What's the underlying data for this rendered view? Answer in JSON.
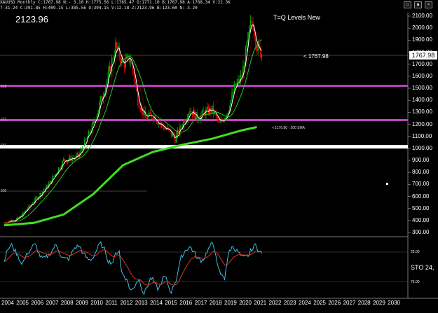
{
  "info": {
    "line1": "XAUUSD Monthly C:1767.98 N:- 3.10 H:1775.56 L:1765.47 O:1771.10 B:1767.98 A:1768.34 V:22.3K",
    "line2": "7-31-24 C:391.85 H:409.15 L:385.56 O:394.15 V:12.18 Z:2123.96 B:123.60 N:-3.20"
  },
  "last_price_label": "2123.96",
  "study_title": "T=Q Levels New",
  "price_note": "< 1767.98",
  "price_tag": "1767.98",
  "sma_note": "< 1176.80 - 200 SMA",
  "left_labels": [
    "818",
    "272",
    "660",
    "500"
  ],
  "price_axis": [
    "2100.00",
    "2000.00",
    "1900.00",
    "1800.00",
    "1700.00",
    "1600.00",
    "1500.00",
    "1400.00",
    "1300.00",
    "1200.00",
    "1100.00",
    "1000.00",
    "900.00",
    "800.00",
    "700.00",
    "600.00",
    "500.00",
    "400.00",
    "300.00"
  ],
  "osc_axis": [
    "25.00",
    "75.00"
  ],
  "sto_label": "STO 24,",
  "years": [
    "2004",
    "2005",
    "2006",
    "2007",
    "2008",
    "2009",
    "2010",
    "2011",
    "2012",
    "2013",
    "2014",
    "2015",
    "2016",
    "2017",
    "2018",
    "2019",
    "2020",
    "2021",
    "2022",
    "2023",
    "2024",
    "2025",
    "2026",
    "2027",
    "2028",
    "2029",
    "2030"
  ],
  "window_controls": [
    "▫",
    "▪",
    "×"
  ],
  "colors": {
    "background": "#000000",
    "up_candle": "#00b000",
    "down_candle": "#e00000",
    "level_magenta": "#c040c0",
    "level_white": "#ffffff",
    "sma_long": "#44dd22",
    "sma_mid": "#22cc22",
    "fast_line": "#ffffff",
    "osc_fast": "#40c0e0",
    "osc_slow": "#e03020"
  },
  "chart_data": {
    "type": "candlestick",
    "title": "T=Q Levels New",
    "levels": [
      {
        "price": 1520,
        "color": "#c040c0"
      },
      {
        "price": 1235,
        "color": "#c040c0"
      },
      {
        "price": 1013,
        "color": "#ffffff"
      }
    ],
    "close_path": [
      [
        2004,
        380
      ],
      [
        2005,
        420
      ],
      [
        2006,
        560
      ],
      [
        2007,
        700
      ],
      [
        2008,
        900
      ],
      [
        2009,
        930
      ],
      [
        2010,
        1200
      ],
      [
        2011,
        1600
      ],
      [
        2011.5,
        1850
      ],
      [
        2012,
        1700
      ],
      [
        2012.5,
        1750
      ],
      [
        2013,
        1400
      ],
      [
        2013.5,
        1250
      ],
      [
        2014,
        1280
      ],
      [
        2014.5,
        1200
      ],
      [
        2015,
        1150
      ],
      [
        2015.5,
        1080
      ],
      [
        2016,
        1200
      ],
      [
        2016.5,
        1330
      ],
      [
        2017,
        1250
      ],
      [
        2017.5,
        1300
      ],
      [
        2018,
        1320
      ],
      [
        2018.5,
        1200
      ],
      [
        2019,
        1300
      ],
      [
        2019.5,
        1500
      ],
      [
        2020,
        1600
      ],
      [
        2020.5,
        1980
      ],
      [
        2020.7,
        2070
      ],
      [
        2021,
        1850
      ],
      [
        2021.4,
        1770
      ]
    ],
    "sma_200": [
      [
        2004,
        360
      ],
      [
        2006,
        380
      ],
      [
        2008,
        450
      ],
      [
        2010,
        620
      ],
      [
        2012,
        860
      ],
      [
        2014,
        970
      ],
      [
        2016,
        1030
      ],
      [
        2018,
        1080
      ],
      [
        2020,
        1150
      ],
      [
        2021,
        1176.8
      ]
    ]
  }
}
